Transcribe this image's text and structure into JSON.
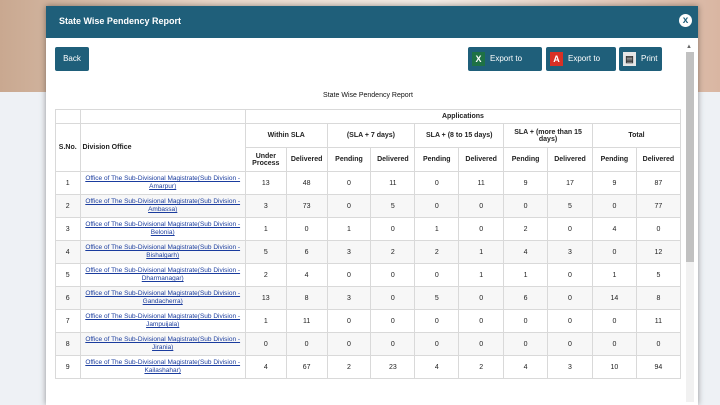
{
  "modal": {
    "title": "State Wise Pendency Report",
    "close_label": "x"
  },
  "toolbar": {
    "back_label": "Back",
    "excel_label": "Export to Exce",
    "pdf_label": "Export to PDF",
    "print_label": "Print",
    "excel_icon": "X",
    "pdf_icon": "A",
    "print_icon": "▤"
  },
  "scroll_up": "▲",
  "report_title": "State Wise Pendency Report",
  "table": {
    "applications": "Applications",
    "sno": "S.No.",
    "division_office": "Division Office",
    "within_sla": "Within SLA",
    "sla7": "(SLA + 7 days)",
    "sla8_15": "SLA + (8 to 15 days)",
    "sla15plus": "SLA + (more than 15 days)",
    "total": "Total",
    "under_process": "Under Process",
    "delivered": "Delivered",
    "pending": "Pending",
    "rows": [
      {
        "sno": "1",
        "office": "Office of The Sub-Divisional Magistrate(Sub Division -Amarpur)",
        "cells": [
          "13",
          "48",
          "0",
          "11",
          "0",
          "11",
          "9",
          "17",
          "9",
          "87"
        ]
      },
      {
        "sno": "2",
        "office": "Office of The Sub-Divisional Magistrate(Sub Division -Ambassa)",
        "cells": [
          "3",
          "73",
          "0",
          "5",
          "0",
          "0",
          "0",
          "5",
          "0",
          "77"
        ]
      },
      {
        "sno": "3",
        "office": "Office of The Sub-Divisional Magistrate(Sub Division -Belonia)",
        "cells": [
          "1",
          "0",
          "1",
          "0",
          "1",
          "0",
          "2",
          "0",
          "4",
          "0"
        ]
      },
      {
        "sno": "4",
        "office": "Office of The Sub-Divisional Magistrate(Sub Division -Bishalgarh)",
        "cells": [
          "5",
          "6",
          "3",
          "2",
          "2",
          "1",
          "4",
          "3",
          "0",
          "12"
        ]
      },
      {
        "sno": "5",
        "office": "Office of The Sub-Divisional Magistrate(Sub Division -Dharmanagar)",
        "cells": [
          "2",
          "4",
          "0",
          "0",
          "0",
          "1",
          "1",
          "0",
          "1",
          "5"
        ]
      },
      {
        "sno": "6",
        "office": "Office of The Sub-Divisional Magistrate(Sub Division -Gandacherra)",
        "cells": [
          "13",
          "8",
          "3",
          "0",
          "5",
          "0",
          "6",
          "0",
          "14",
          "8"
        ]
      },
      {
        "sno": "7",
        "office": "Office of The Sub-Divisional Magistrate(Sub Division -Jampuijala)",
        "cells": [
          "1",
          "11",
          "0",
          "0",
          "0",
          "0",
          "0",
          "0",
          "0",
          "11"
        ]
      },
      {
        "sno": "8",
        "office": "Office of The Sub-Divisional Magistrate(Sub Division -Jirania)",
        "cells": [
          "0",
          "0",
          "0",
          "0",
          "0",
          "0",
          "0",
          "0",
          "0",
          "0"
        ]
      },
      {
        "sno": "9",
        "office": "Office of The Sub-Divisional Magistrate(Sub Division -Kailashahar)",
        "cells": [
          "4",
          "67",
          "2",
          "23",
          "4",
          "2",
          "4",
          "3",
          "10",
          "94"
        ]
      }
    ]
  }
}
